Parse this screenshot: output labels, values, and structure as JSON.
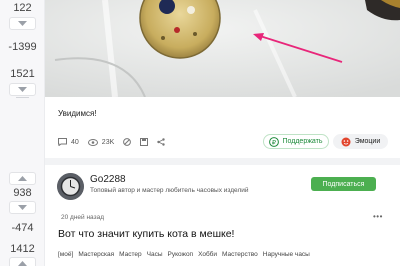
{
  "votes": {
    "post1": {
      "rating": "122",
      "negative": "-1399",
      "positive": "1521"
    },
    "post2": {
      "rating": "938",
      "negative": "-474",
      "positive": "1412"
    }
  },
  "post1": {
    "caption": "Увидимся!",
    "comments": "40",
    "views": "23K",
    "support_label": "Поддержать",
    "emotions_label": "Эмоции"
  },
  "post2": {
    "author": "Go2288",
    "bio": "Топовый автор и мастер любитель часовых изделий",
    "subscribe_label": "Подписаться",
    "posted": "20 дней назад",
    "more": "•••",
    "title": "Вот что значит купить кота в мешке!",
    "tags": [
      "[моё]",
      "Мастерская",
      "Мастер",
      "Часы",
      "Рукожоп",
      "Хобби",
      "Мастерство",
      "Наручные часы"
    ]
  },
  "colors": {
    "accent_green": "#4caf50",
    "arrow": "#e8267a"
  },
  "icons": [
    "arrow-up-icon",
    "arrow-down-icon",
    "comment-icon",
    "eye-icon",
    "block-icon",
    "save-icon",
    "share-icon",
    "ruble-icon",
    "emotion-icon"
  ]
}
